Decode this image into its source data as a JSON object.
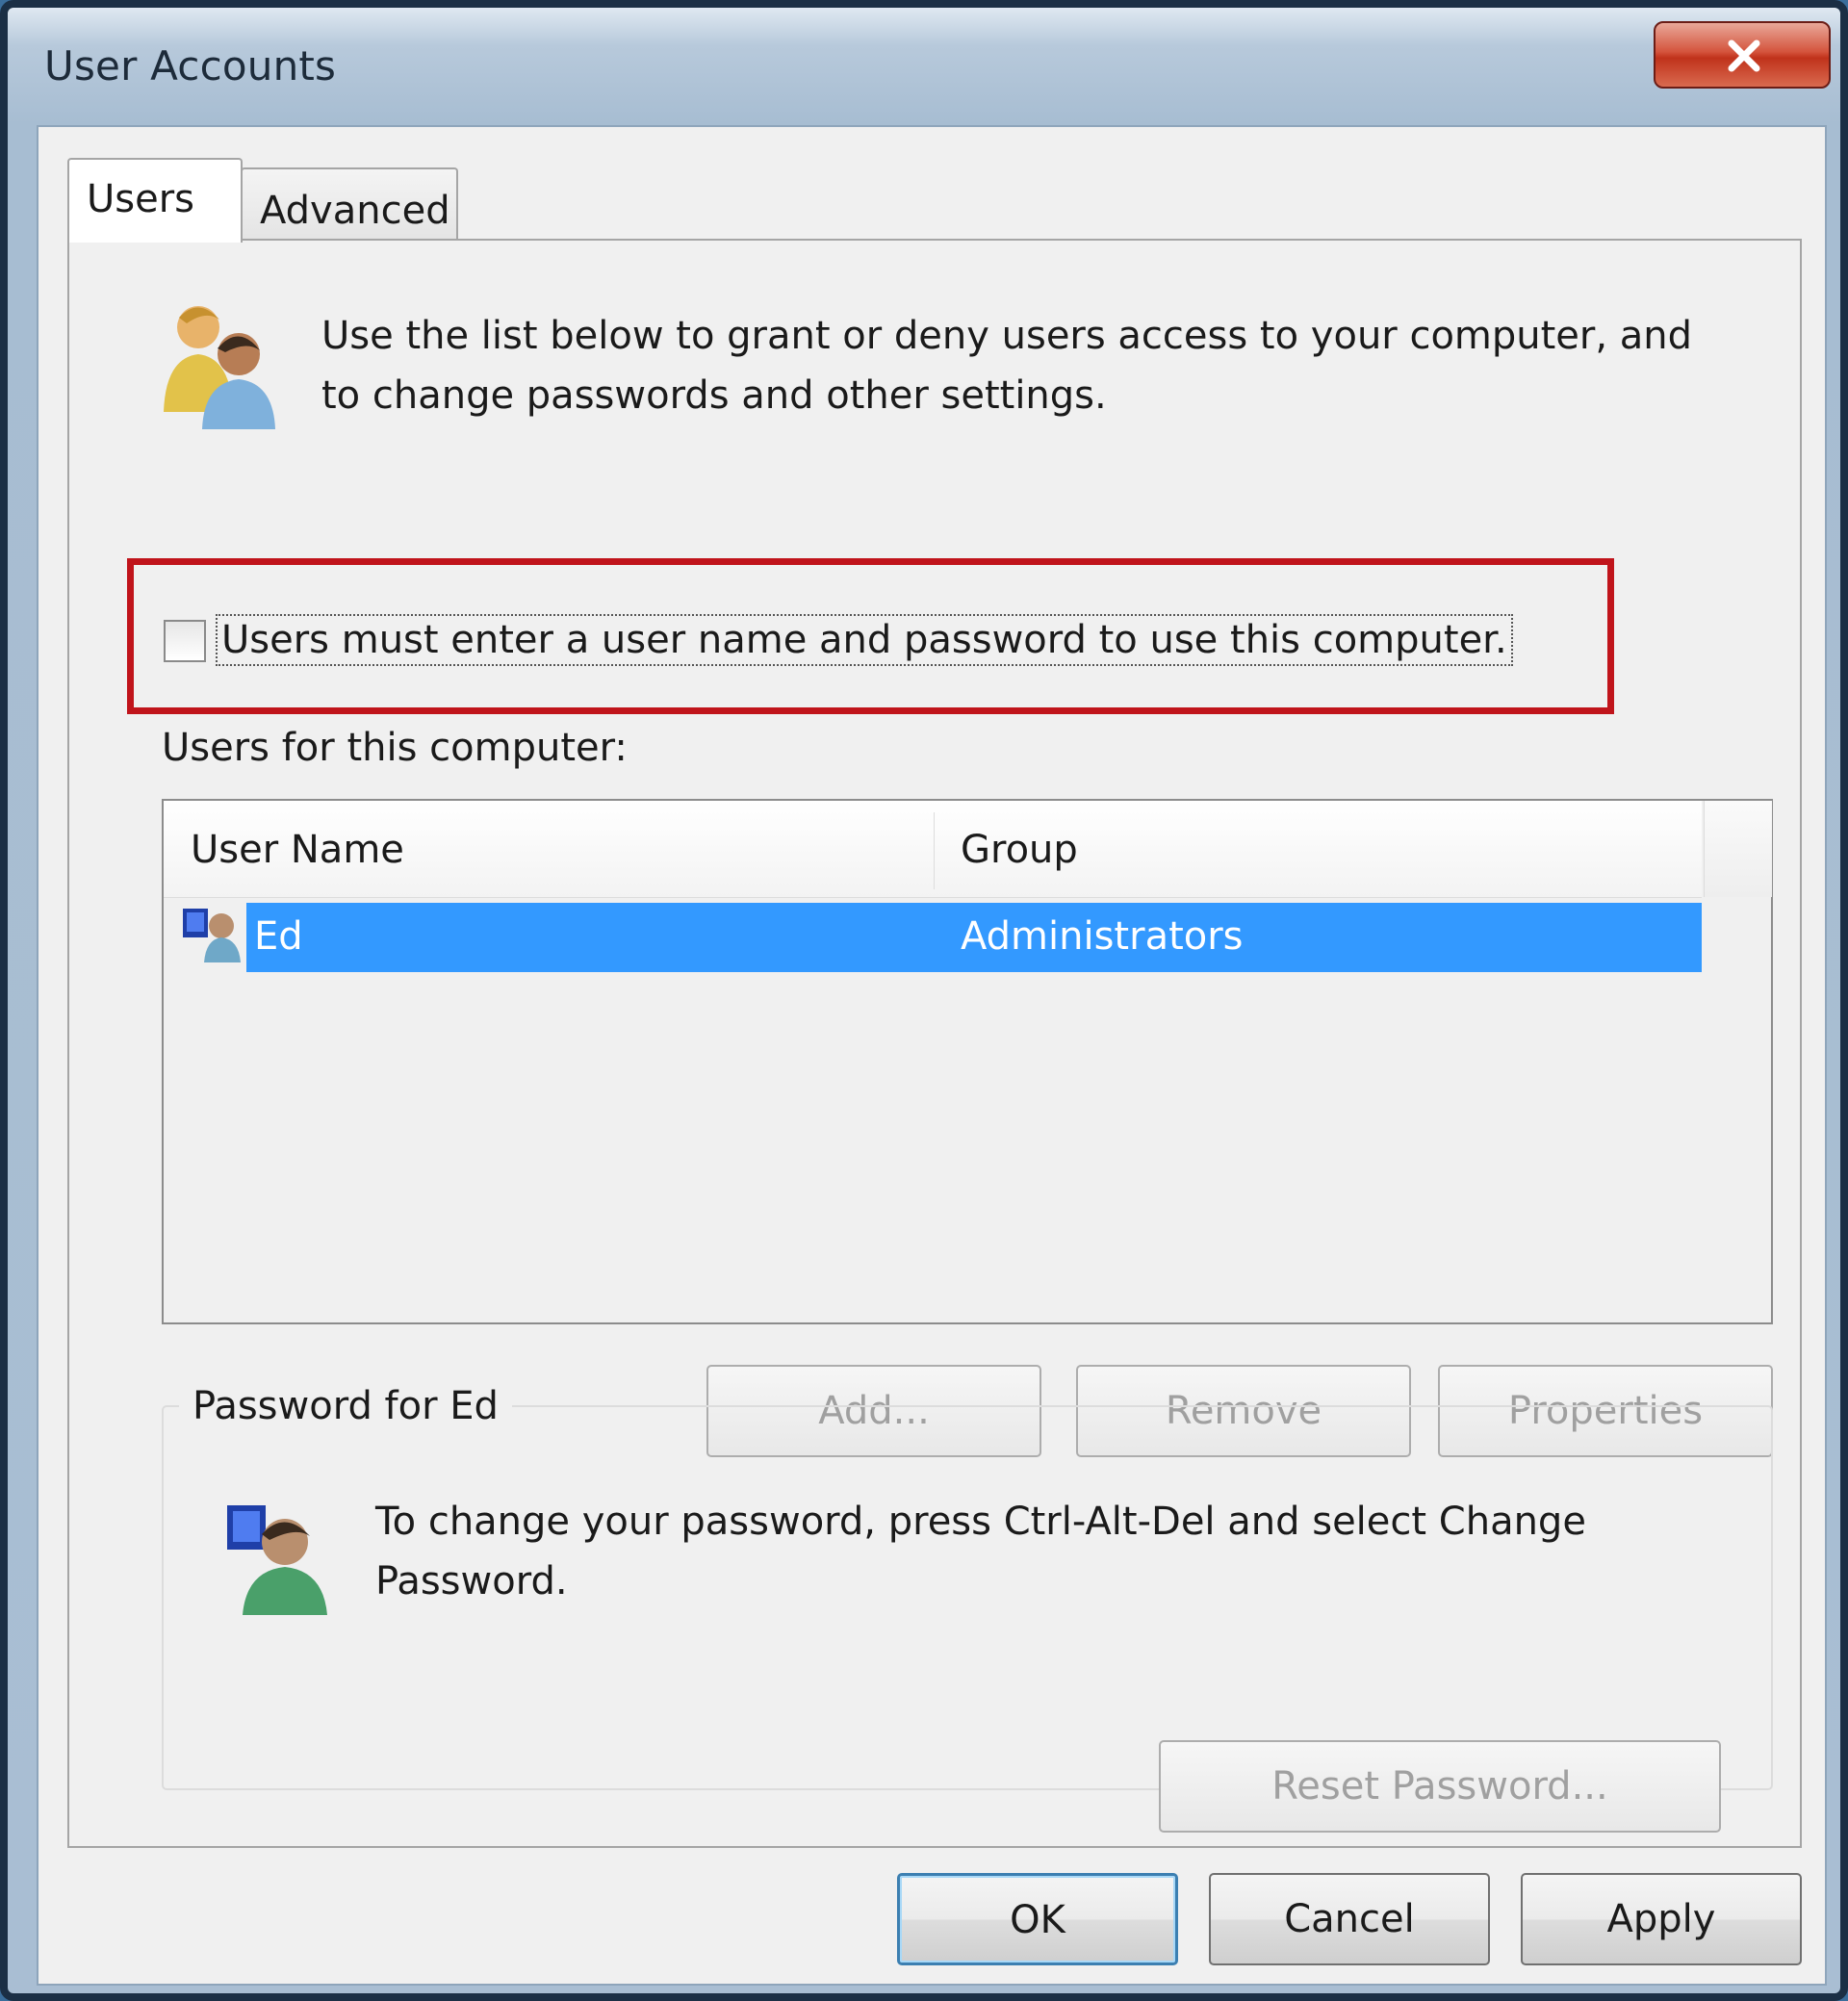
{
  "window": {
    "title": "User Accounts"
  },
  "tabs": [
    {
      "label": "Users",
      "selected": true
    },
    {
      "label": "Advanced",
      "selected": false
    }
  ],
  "intro": {
    "text": "Use the list below to grant or deny users access to your computer, and to change passwords and other settings."
  },
  "require_login": {
    "label": "Users must enter a user name and password to use this computer.",
    "checked": false
  },
  "users_list": {
    "label": "Users for this computer:",
    "columns": [
      "User Name",
      "Group"
    ],
    "rows": [
      {
        "user_name": "Ed",
        "group": "Administrators",
        "selected": true
      }
    ]
  },
  "list_buttons": {
    "add": "Add...",
    "remove": "Remove",
    "properties": "Properties"
  },
  "password_group": {
    "title": "Password for Ed",
    "text": "To change your password, press Ctrl-Alt-Del and select Change Password.",
    "reset_button": "Reset Password..."
  },
  "dialog_buttons": {
    "ok": "OK",
    "cancel": "Cancel",
    "apply": "Apply"
  },
  "colors": {
    "selection": "#3399ff",
    "highlight_box": "#c0141b"
  },
  "icons": {
    "intro": "users-group-icon",
    "row": "user-account-icon",
    "password": "user-password-icon",
    "close": "close-icon"
  }
}
